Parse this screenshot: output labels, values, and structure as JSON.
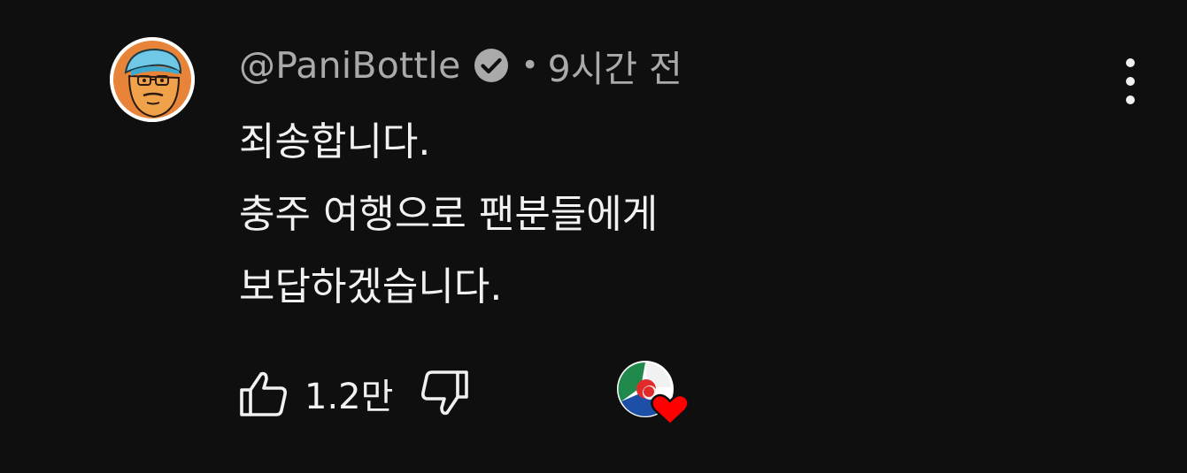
{
  "comment": {
    "author": "@PaniBottle",
    "separator": "•",
    "time": "9시간 전",
    "lines": [
      "죄송합니다.",
      "충주 여행으로 팬분들에게",
      "보답하겠습니다."
    ],
    "like_count": "1.2만"
  },
  "icons": {
    "verified": "check-circle-icon",
    "more": "more-vert-icon",
    "like": "thumb-up-icon",
    "dislike": "thumb-down-icon",
    "heart": "heart-icon"
  },
  "colors": {
    "background": "#0f0f0f",
    "text": "#f1f1f1",
    "secondary_text": "#aaaaaa",
    "heart": "#ff0000"
  }
}
